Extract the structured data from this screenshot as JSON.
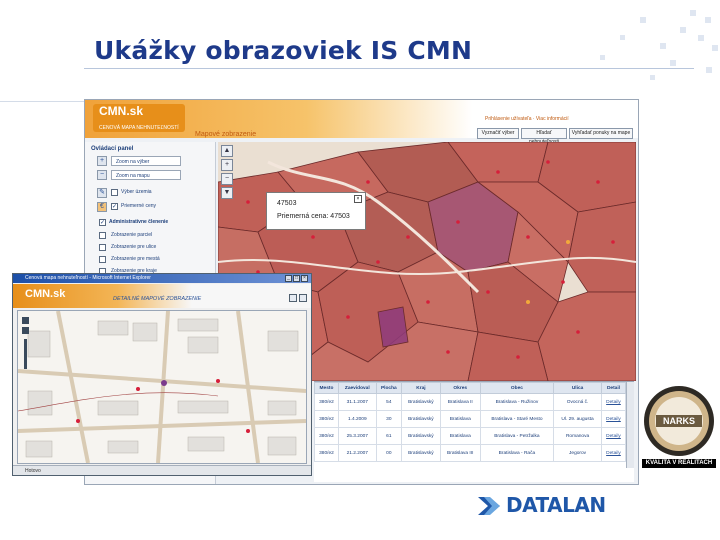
{
  "slide": {
    "title": "Ukážky obrazoviek IS CMN",
    "brand": "DATALAN",
    "badge_text": "KVALITA V REALITACH",
    "seal_text": "NARKS"
  },
  "main_window": {
    "logo": "CMN.sk",
    "logo_sub": "CENOVÁ MAPA NEHNUTEĽNOSTÍ",
    "view_title": "Mapové zobrazenie",
    "top_link": "Prihlásenie užívateľa · Viac informácií",
    "buttons": [
      "Vyznačiť výber",
      "Hľadať nehnuteľnosti",
      "Vyhľadať ponuky na mape"
    ],
    "panel_title": "Ovládací panel",
    "zoom_in": "Zoom na výber",
    "zoom_out": "Zoom na mapu",
    "layers": [
      {
        "label": "Výber územia",
        "checked": false
      },
      {
        "label": "Priemerné ceny",
        "checked": true
      },
      {
        "label": "Administratívne členenie",
        "checked": true
      }
    ],
    "sublayers": [
      "Zobrazenie parciel",
      "Zobrazenie pre ulice",
      "Zobrazenie pre mestá",
      "Zobrazenie pre kraje"
    ],
    "popup": {
      "id": "47503",
      "label": "Priemerná cena: 47503"
    },
    "table": {
      "headers": [
        "Mesto",
        "Zaevidoval",
        "Plocha",
        "Kraj",
        "Okres",
        "Obec",
        "Ulica",
        "Detail"
      ],
      "rows": [
        [
          "380/e2",
          "31.1.2007",
          "54",
          "Bratislavský",
          "Bratislava II",
          "Bratislava - Ružinov",
          "Ovocná č.",
          "Detaily"
        ],
        [
          "380/e2",
          "1.4.2009",
          "30",
          "Bratislavský",
          "Bratislava",
          "Bratislava - Staré Mesto",
          "Ul. 29. augusta",
          "Detaily"
        ],
        [
          "380/e2",
          "25.3.2007",
          "61",
          "Bratislavský",
          "Bratislava",
          "Bratislava - Petržalka",
          "Romanova",
          "Detaily"
        ],
        [
          "380/e2",
          "21.2.2007",
          "00",
          "Bratislavský",
          "Bratislava III",
          "Bratislava - Rača",
          "Jegorov",
          "Detaily"
        ]
      ]
    }
  },
  "inset_window": {
    "title": "Cenová mapa nehnuteľností - Microsoft Internet Explorer",
    "logo": "CMN.sk",
    "view_title": "DETAILNÉ MAPOVÉ ZOBRAZENIE",
    "status": "Hotovo"
  },
  "colors": {
    "title": "#1e3a8a",
    "accent": "#e78f1a",
    "map_red": "#c0392b",
    "map_purple": "#8e3b7d",
    "brand_blue": "#1f57a8"
  }
}
